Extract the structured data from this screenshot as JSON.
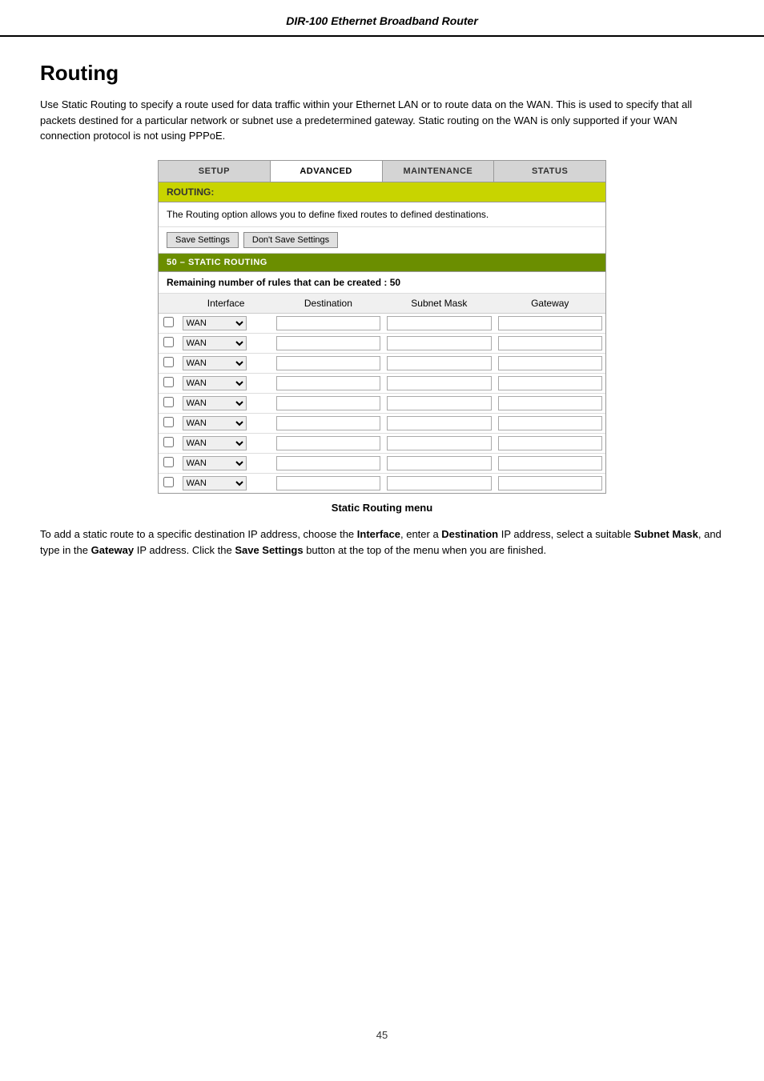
{
  "header": {
    "title": "DIR-100 Ethernet Broadband Router"
  },
  "page": {
    "title": "Routing",
    "intro": "Use Static Routing to specify a route used for data traffic within your Ethernet LAN or to route data on the WAN. This is used to specify that all packets destined for a particular network or subnet use a predetermined gateway. Static routing on the WAN is only supported if your WAN connection protocol is not using PPPoE."
  },
  "nav": {
    "tabs": [
      "SETUP",
      "ADVANCED",
      "MAINTENANCE",
      "STATUS"
    ],
    "active": "ADVANCED"
  },
  "routing": {
    "section_label": "ROUTING:",
    "desc": "The Routing option allows you to define fixed routes to defined destinations.",
    "save_label": "Save Settings",
    "dont_save_label": "Don't Save Settings",
    "sub_section": "50 – STATIC ROUTING",
    "remaining_text": "Remaining number of rules that can be created : ",
    "remaining_count": "50",
    "columns": [
      "Interface",
      "Destination",
      "Subnet Mask",
      "Gateway"
    ],
    "rows": [
      {
        "interface": "WAN",
        "destination": "",
        "subnet_mask": "",
        "gateway": ""
      },
      {
        "interface": "WAN",
        "destination": "",
        "subnet_mask": "",
        "gateway": ""
      },
      {
        "interface": "WAN",
        "destination": "",
        "subnet_mask": "",
        "gateway": ""
      },
      {
        "interface": "WAN",
        "destination": "",
        "subnet_mask": "",
        "gateway": ""
      },
      {
        "interface": "WAN",
        "destination": "",
        "subnet_mask": "",
        "gateway": ""
      },
      {
        "interface": "WAN",
        "destination": "",
        "subnet_mask": "",
        "gateway": ""
      },
      {
        "interface": "WAN",
        "destination": "",
        "subnet_mask": "",
        "gateway": ""
      },
      {
        "interface": "WAN",
        "destination": "",
        "subnet_mask": "",
        "gateway": ""
      },
      {
        "interface": "WAN",
        "destination": "",
        "subnet_mask": "",
        "gateway": ""
      }
    ]
  },
  "caption": "Static Routing menu",
  "body_text": "To add a static route to a specific destination IP address, choose the Interface, enter a Destination IP address, select a suitable Subnet Mask, and type in the Gateway IP address. Click the Save Settings button at the top of the menu when you are finished.",
  "footer": {
    "page_number": "45"
  }
}
